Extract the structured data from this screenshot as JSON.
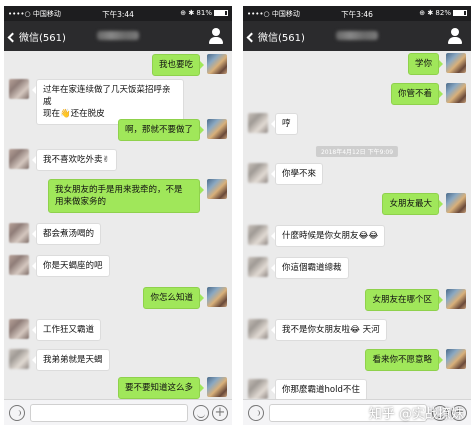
{
  "left": {
    "status": {
      "carrier": "••••○ 中国移动 ",
      "time": "下午3:44",
      "battery": "⊕ ✱ 81%"
    },
    "nav": {
      "back_label": "微信(561)"
    },
    "messages": [
      {
        "side": "out",
        "text": "我也要吃"
      },
      {
        "side": "in",
        "text": "过年在家连续做了几天饭菜招呼亲戚\n现在👋还在脱皮"
      },
      {
        "side": "out",
        "text": "啊，那就不要做了"
      },
      {
        "side": "in",
        "text": "我不喜欢吃外卖✌"
      },
      {
        "side": "out",
        "text": "我女朋友的手是用来我牵的，不是\n用来做家务的"
      },
      {
        "side": "in",
        "text": "都会煮汤喝的"
      },
      {
        "side": "in",
        "text": "你是天蝎座的吧"
      },
      {
        "side": "out",
        "text": "你怎么知道"
      },
      {
        "side": "in",
        "text": "工作狂又霸道"
      },
      {
        "side": "in",
        "text": "我弟弟就是天蝎"
      },
      {
        "side": "out",
        "text": "要不要知道这么多"
      }
    ]
  },
  "right": {
    "status": {
      "carrier": "••••○ 中国移动 ",
      "time": "下午3:46",
      "battery": "⊕ ✱ 82%"
    },
    "nav": {
      "back_label": "微信(561)"
    },
    "timestamp": "2018年4月12日 下午9:09",
    "messages": [
      {
        "side": "out",
        "text": "学你"
      },
      {
        "side": "out",
        "text": "你管不着"
      },
      {
        "side": "in",
        "text": "哼"
      },
      {
        "side": "in",
        "text": "你學不來"
      },
      {
        "side": "out",
        "text": "女朋友最大"
      },
      {
        "side": "in",
        "text": "什麼時候是你女朋友😂😂"
      },
      {
        "side": "in",
        "text": "你這個霸道總裁"
      },
      {
        "side": "out",
        "text": "女朋友在哪个区"
      },
      {
        "side": "in",
        "text": "我不是你女朋友啦😂 天河"
      },
      {
        "side": "out",
        "text": "看来你不愿意略"
      },
      {
        "side": "in",
        "text": "你那麼霸道hold不住"
      }
    ]
  },
  "watermark": "知乎 @实战撩妹",
  "colors": {
    "bubble_out": "#a0e75a",
    "bubble_in": "#ffffff",
    "chat_bg": "#ebebeb",
    "nav_bg": "#2b2b2d"
  }
}
